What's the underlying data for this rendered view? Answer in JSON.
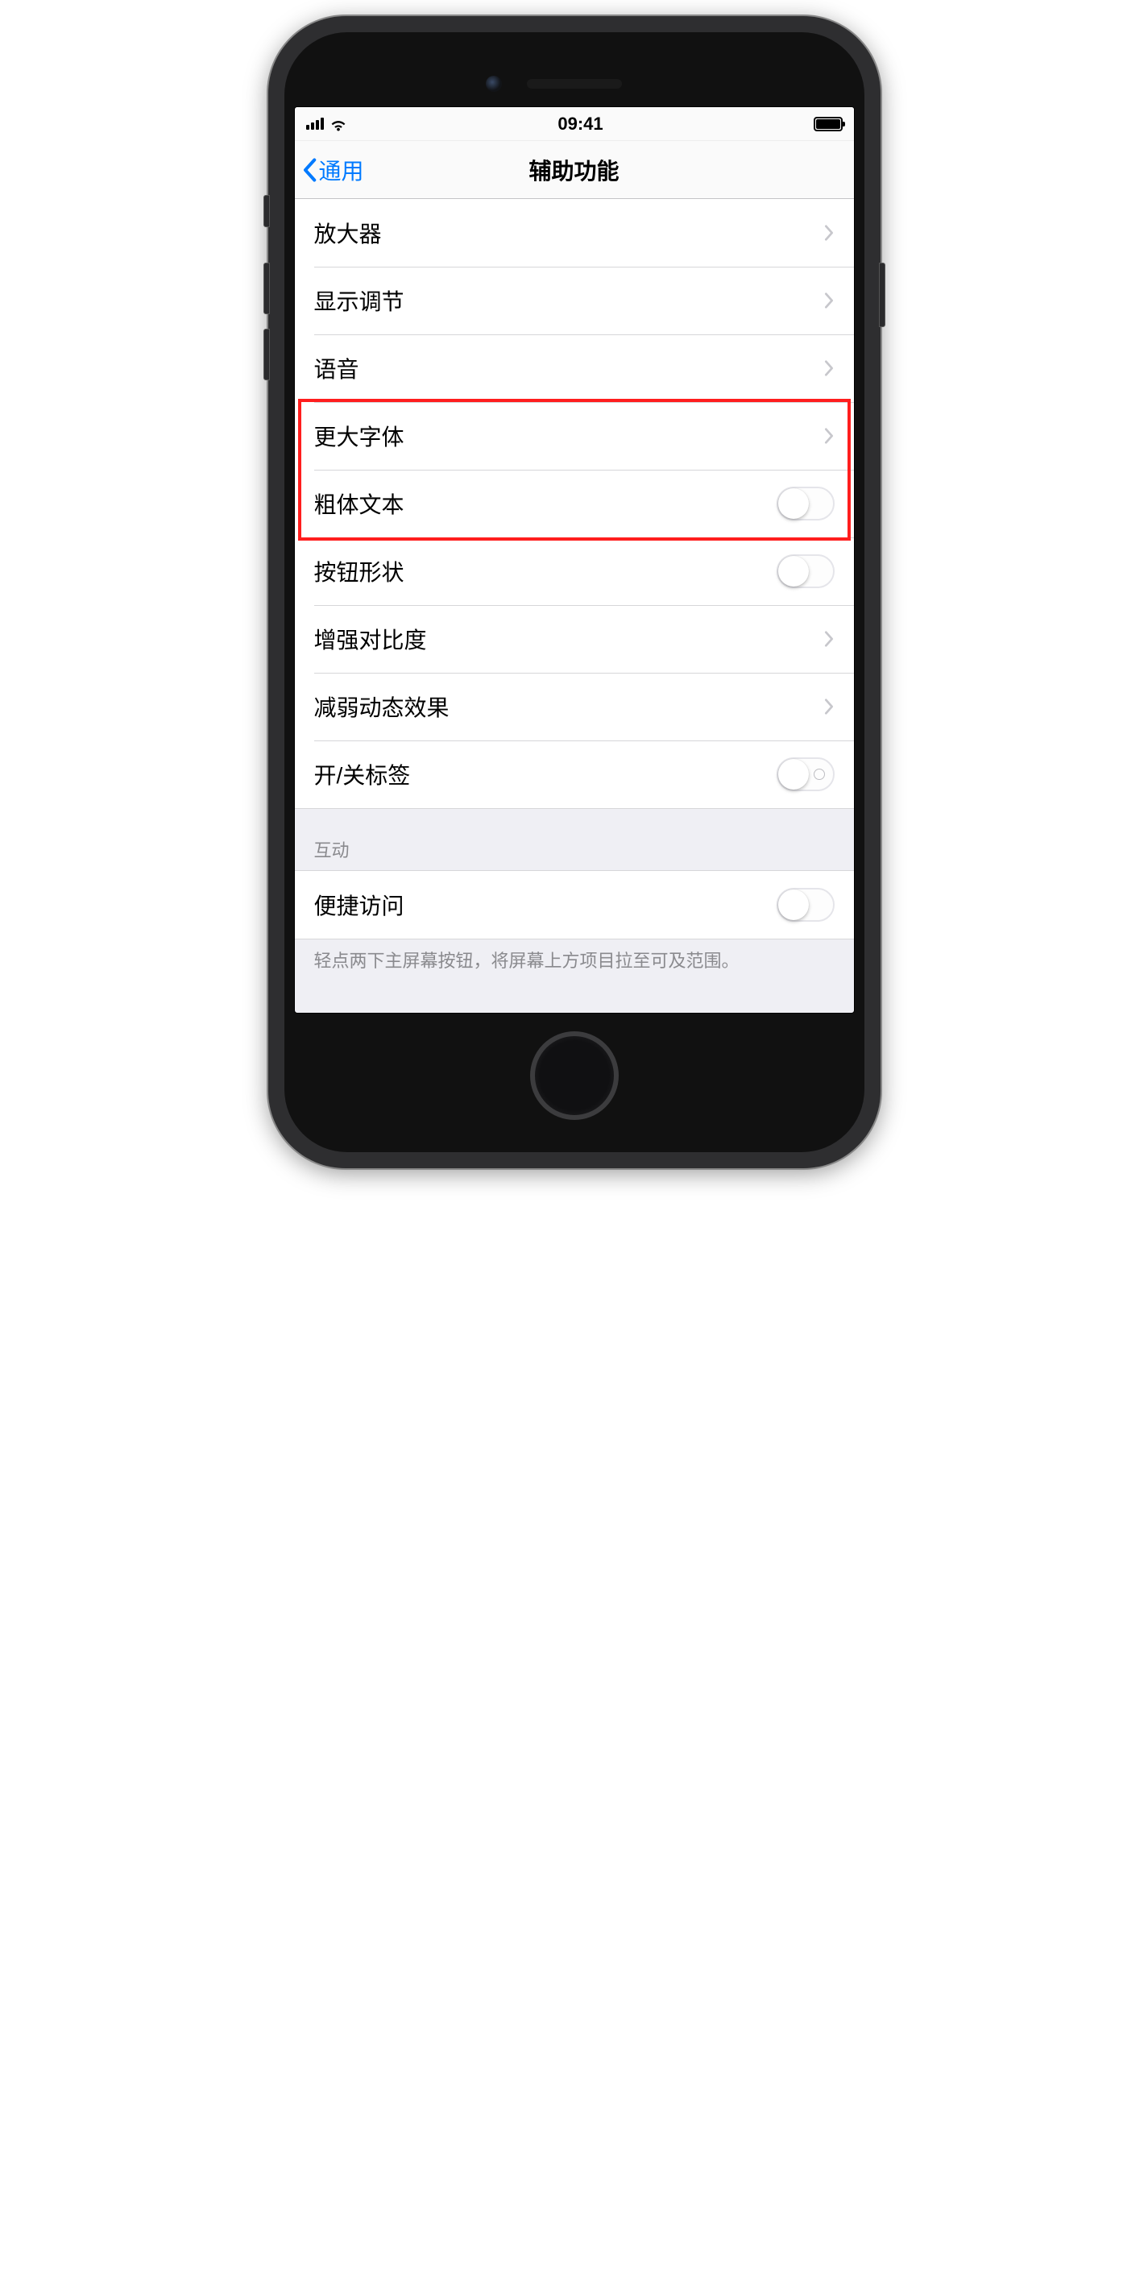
{
  "status": {
    "time": "09:41"
  },
  "nav": {
    "back_label": "通用",
    "title": "辅助功能"
  },
  "rows": {
    "magnifier": "放大器",
    "display_adjust": "显示调节",
    "speech": "语音",
    "larger_text": "更大字体",
    "bold_text": "粗体文本",
    "button_shapes": "按钮形状",
    "increase_contrast": "增强对比度",
    "reduce_motion": "减弱动态效果",
    "on_off_labels": "开/关标签",
    "reachability": "便捷访问"
  },
  "sections": {
    "interaction_header": "互动",
    "reachability_footer": "轻点两下主屏幕按钮，将屏幕上方项目拉至可及范围。"
  }
}
